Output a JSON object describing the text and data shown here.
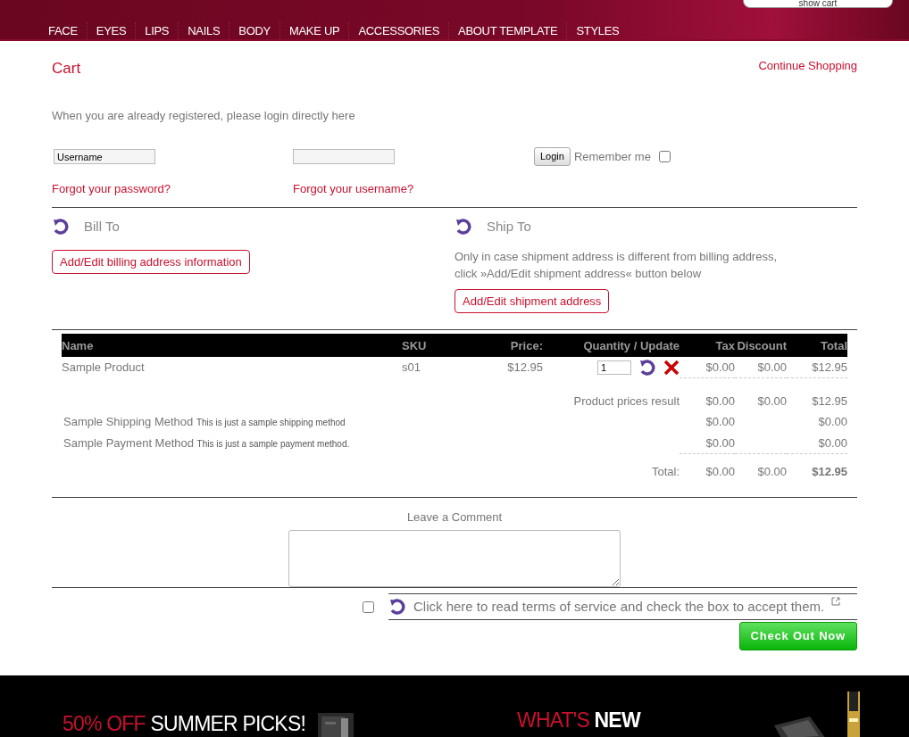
{
  "header": {
    "show_cart_button": "show cart",
    "nav": [
      "FACE",
      "EYES",
      "LIPS",
      "NAILS",
      "BODY",
      "MAKE UP",
      "ACCESSORIES",
      "ABOUT TEMPLATE",
      "STYLES"
    ]
  },
  "cart": {
    "title": "Cart",
    "continue_link": "Continue Shopping"
  },
  "login": {
    "intro": "When you are already registered, please login directly here",
    "username_value": "Username",
    "login_button": "Login",
    "remember_label": "Remember me",
    "remember_checked": false,
    "forgot_password": "Forgot your password?",
    "forgot_username": "Forgot your username?"
  },
  "bill_to": {
    "title": "Bill To",
    "button": "Add/Edit billing address information"
  },
  "ship_to": {
    "title": "Ship To",
    "note": "Only in case shipment address is different from billing address, click »Add/Edit shipment address« button below",
    "button": "Add/Edit shipment address"
  },
  "table": {
    "columns": [
      "Name",
      "SKU",
      "Price:",
      "Quantity / Update",
      "Tax",
      "Discount",
      "Total"
    ],
    "rows": [
      {
        "name": "Sample Product",
        "sku": "s01",
        "price": "$12.95",
        "quantity": "1",
        "tax": "$0.00",
        "discount": "$0.00",
        "total": "$12.95"
      }
    ],
    "subtotal": {
      "label": "Product prices result",
      "tax": "$0.00",
      "discount": "$0.00",
      "total": "$12.95"
    },
    "methods": [
      {
        "name": "Sample Shipping Method",
        "description": "This is just a sample shipping method",
        "tax": "$0.00",
        "total": "$0.00"
      },
      {
        "name": "Sample Payment Method",
        "description": "This is just a sample payment method.",
        "tax": "$0.00",
        "total": "$0.00"
      }
    ],
    "grand_total": {
      "label": "Total:",
      "tax": "$0.00",
      "discount": "$0.00",
      "total": "$12.95"
    }
  },
  "comment": {
    "label": "Leave a Comment"
  },
  "terms": {
    "checked": false,
    "text": "Click here to read terms of service and check the box to accept them."
  },
  "checkout_button": "Check Out Now",
  "promos": [
    {
      "highlight": "50% OFF",
      "text": "SUMMER PICKS!"
    },
    {
      "highlight": "WHAT'S",
      "text": "NEW"
    }
  ]
}
